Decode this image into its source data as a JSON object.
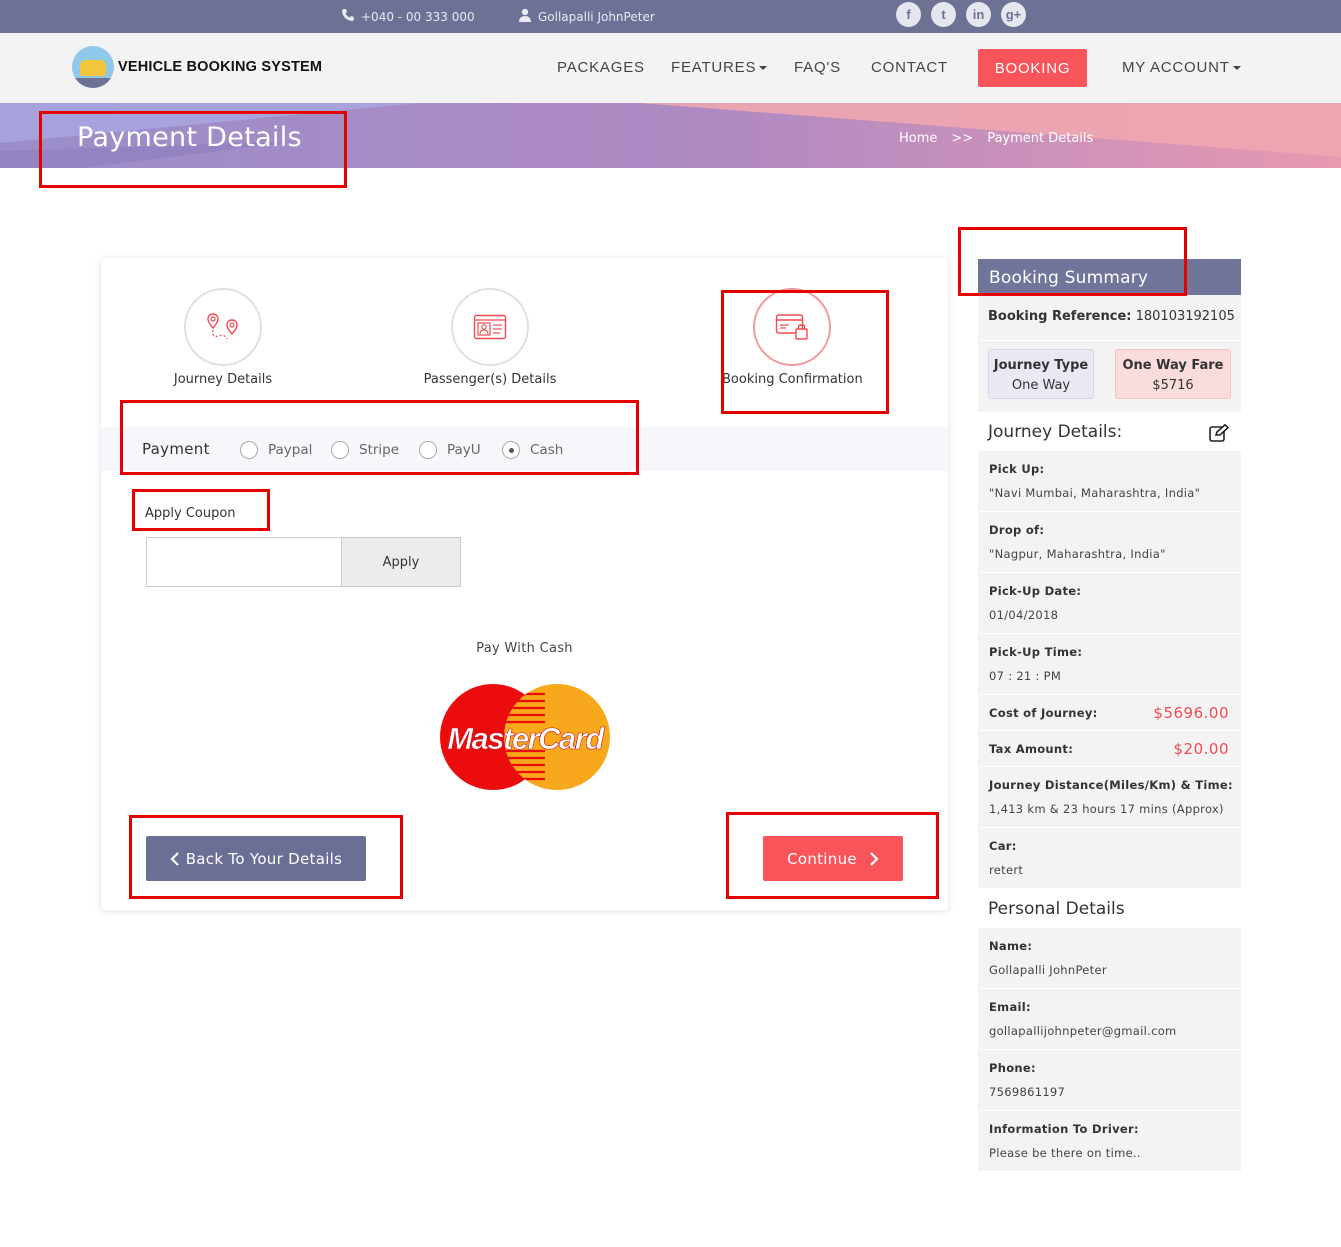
{
  "topbar": {
    "phone": "+040 - 00 333 000",
    "user": "Gollapalli JohnPeter",
    "social": [
      {
        "icon": "facebook-icon",
        "glyph": "f"
      },
      {
        "icon": "twitter-icon",
        "glyph": "t"
      },
      {
        "icon": "linkedin-icon",
        "glyph": "in"
      },
      {
        "icon": "google-plus-icon",
        "glyph": "g+"
      }
    ]
  },
  "nav": {
    "logo_text": "VEHICLE BOOKING SYSTEM",
    "items": [
      "PACKAGES",
      "FEATURES",
      "FAQ'S",
      "CONTACT",
      "BOOKING",
      "MY ACCOUNT"
    ]
  },
  "banner": {
    "title": "Payment Details",
    "crumb_home": "Home",
    "crumb_sep": ">>",
    "crumb_current": "Payment Details"
  },
  "steps": [
    "Journey Details",
    "Passenger(s) Details",
    "Booking Confirmation"
  ],
  "payment": {
    "label": "Payment",
    "options": [
      "Paypal",
      "Stripe",
      "PayU",
      "Cash"
    ],
    "selected": "Cash"
  },
  "coupon": {
    "label": "Apply Coupon",
    "value": "",
    "button": "Apply"
  },
  "pay_with": "Pay With Cash",
  "card_logo": "MasterCard",
  "buttons": {
    "back": "Back To Your Details",
    "continue": "Continue"
  },
  "summary": {
    "title": "Booking Summary",
    "ref_label": "Booking Reference:",
    "ref_value": "180103192105",
    "journey_type_label": "Journey Type",
    "journey_type_value": "One Way",
    "fare_label": "One Way Fare",
    "fare_value": "$5716",
    "journey_heading": "Journey Details:",
    "pickup_label": "Pick Up:",
    "pickup_value": "\"Navi Mumbai, Maharashtra, India\"",
    "drop_label": "Drop of:",
    "drop_value": "\"Nagpur, Maharashtra, India\"",
    "date_label": "Pick-Up Date:",
    "date_value": "01/04/2018",
    "time_label": "Pick-Up Time:",
    "time_value": "07 : 21 : PM",
    "cost_label": "Cost of Journey:",
    "cost_value": "$5696.00",
    "tax_label": "Tax Amount:",
    "tax_value": "$20.00",
    "distance_label": "Journey Distance(Miles/Km) & Time:",
    "distance_value": "1,413 km & 23 hours 17 mins (Approx)",
    "car_label": "Car:",
    "car_value": "retert",
    "personal_heading": "Personal Details",
    "name_label": "Name:",
    "name_value": "Gollapalli JohnPeter",
    "email_label": "Email:",
    "email_value": "gollapallijohnpeter@gmail.com",
    "phone_label": "Phone:",
    "phone_value": "7569861197",
    "info_label": "Information To Driver:",
    "info_value": "Please be there on time.."
  },
  "colors": {
    "topbar": "#6d7194",
    "accent": "#f8545a",
    "back_button": "#6b6f96",
    "annotation": "#e60000"
  }
}
